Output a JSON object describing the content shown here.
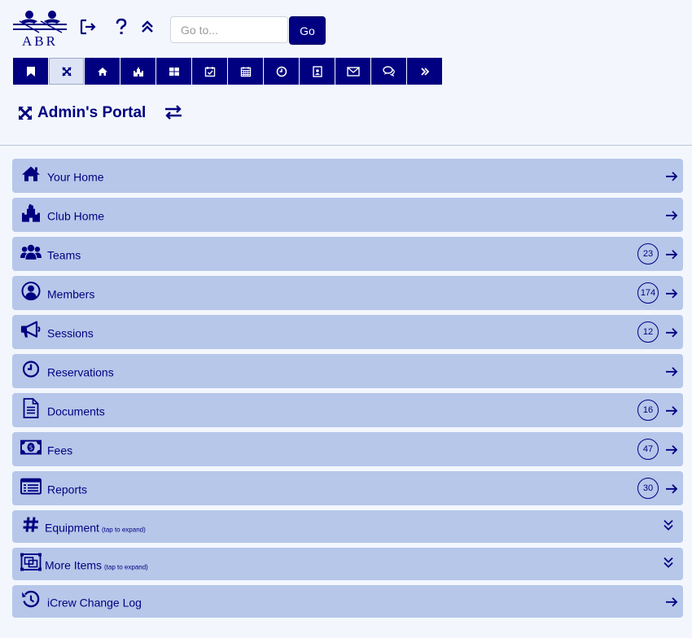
{
  "header": {
    "logo_text": "ABR",
    "search": {
      "placeholder": "Go to...",
      "value": ""
    },
    "go_label": "Go",
    "icons": [
      "logout-icon",
      "help-icon",
      "collapse-up-icon"
    ]
  },
  "tabs": [
    {
      "icon": "bookmark-icon",
      "active": false
    },
    {
      "icon": "expand-icon",
      "active": true
    },
    {
      "icon": "home-icon",
      "active": false
    },
    {
      "icon": "castle-icon",
      "active": false
    },
    {
      "icon": "dashboard-icon",
      "active": false
    },
    {
      "icon": "calendar-check-icon",
      "active": false
    },
    {
      "icon": "calendar-icon",
      "active": false
    },
    {
      "icon": "clock-icon",
      "active": false
    },
    {
      "icon": "contacts-icon",
      "active": false
    },
    {
      "icon": "mail-icon",
      "active": false
    },
    {
      "icon": "chat-icon",
      "active": false
    },
    {
      "icon": "more-icon",
      "active": false
    }
  ],
  "portal": {
    "title": "Admin's Portal"
  },
  "menu": [
    {
      "label": "Your Home",
      "icon": "home-icon",
      "count": null
    },
    {
      "label": "Club Home",
      "icon": "castle-icon",
      "count": null
    },
    {
      "label": "Teams",
      "icon": "team-icon",
      "count": "23"
    },
    {
      "label": "Members",
      "icon": "user-icon",
      "count": "174"
    },
    {
      "label": "Sessions",
      "icon": "megaphone-icon",
      "count": "12"
    },
    {
      "label": "Reservations",
      "icon": "clock-icon",
      "count": null
    },
    {
      "label": "Documents",
      "icon": "document-icon",
      "count": "16"
    },
    {
      "label": "Fees",
      "icon": "money-icon",
      "count": "47"
    },
    {
      "label": "Reports",
      "icon": "report-icon",
      "count": "30"
    },
    {
      "label": "Equipment",
      "hint": "(tap to expand)",
      "icon": "hash-icon",
      "expand": true
    },
    {
      "label": "More Items",
      "hint": "(tap to expand)",
      "icon": "windows-icon",
      "expand": true
    },
    {
      "label": "iCrew Change Log",
      "icon": "history-icon",
      "count": null
    }
  ],
  "colors": {
    "primary": "#000080",
    "row_bg": "#b6c7ea",
    "page_bg": "#f3f7fd"
  }
}
